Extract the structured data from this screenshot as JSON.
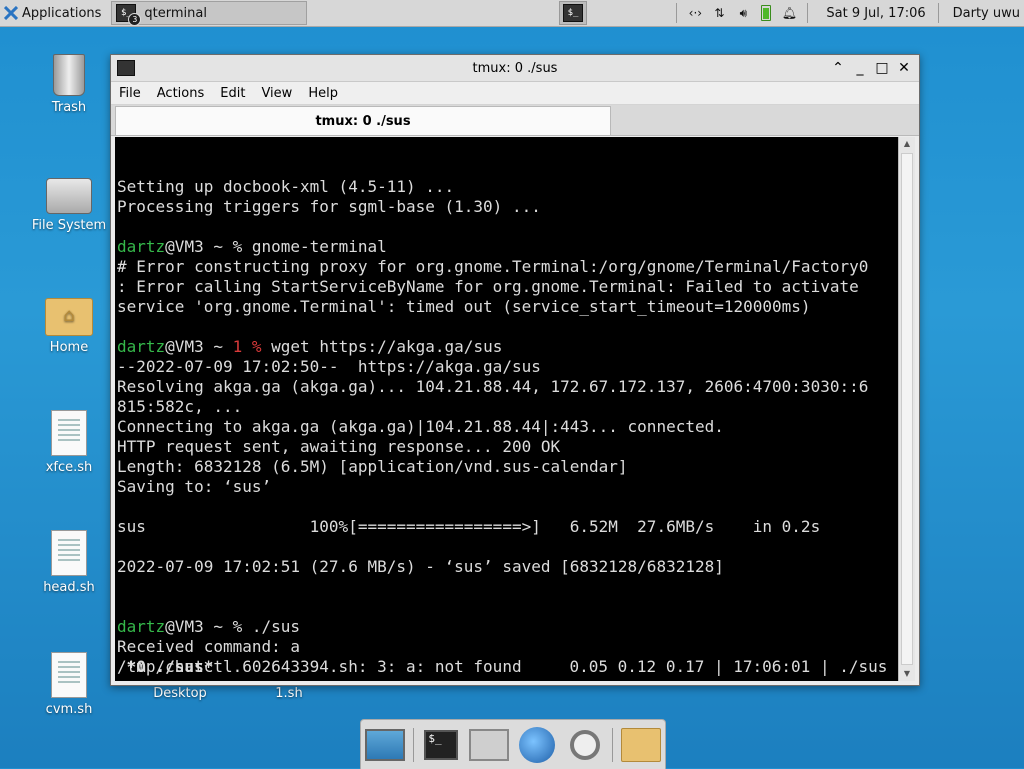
{
  "top_panel": {
    "applications_label": "Applications",
    "task_label": "qterminal",
    "task_badge": "3",
    "clock": "Sat  9 Jul, 17:06",
    "user": "Darty uwu",
    "tray_icons": [
      "network-icon",
      "transfer-icon",
      "volume-icon",
      "battery-icon",
      "bell-icon"
    ]
  },
  "desktop": {
    "icons": [
      {
        "label": "Trash",
        "icon": "trash-icon"
      },
      {
        "label": "File System",
        "icon": "drive-icon"
      },
      {
        "label": "Home",
        "icon": "home-folder-icon"
      },
      {
        "label": "xfce.sh",
        "icon": "script-file-icon"
      },
      {
        "label": "head.sh",
        "icon": "script-file-icon"
      },
      {
        "label": "cvm.sh",
        "icon": "script-file-icon"
      },
      {
        "label": "Desktop",
        "icon": "folder-icon"
      },
      {
        "label": "1.sh",
        "icon": "script-file-icon"
      }
    ]
  },
  "window": {
    "title": "tmux: 0 ./sus",
    "menu": [
      "File",
      "Actions",
      "Edit",
      "View",
      "Help"
    ],
    "tab_label": "tmux: 0 ./sus"
  },
  "terminal": {
    "lines": [
      [
        {
          "t": "Setting up docbook-xml (4.5-11) ..."
        }
      ],
      [
        {
          "t": "Processing triggers for sgml-base (1.30) ..."
        }
      ],
      [
        {
          "t": ""
        }
      ],
      [
        {
          "t": "dartz",
          "c": "g"
        },
        {
          "t": "@VM3 ~ % gnome-terminal"
        }
      ],
      [
        {
          "t": "# Error constructing proxy for org.gnome.Terminal:/org/gnome/Terminal/Factory0"
        }
      ],
      [
        {
          "t": ": Error calling StartServiceByName for org.gnome.Terminal: Failed to activate"
        }
      ],
      [
        {
          "t": "service 'org.gnome.Terminal': timed out (service_start_timeout=120000ms)"
        }
      ],
      [
        {
          "t": ""
        }
      ],
      [
        {
          "t": "dartz",
          "c": "g"
        },
        {
          "t": "@VM3 ~ "
        },
        {
          "t": "1 %",
          "c": "r"
        },
        {
          "t": " wget https://akga.ga/sus"
        }
      ],
      [
        {
          "t": "--2022-07-09 17:02:50--  https://akga.ga/sus"
        }
      ],
      [
        {
          "t": "Resolving akga.ga (akga.ga)... 104.21.88.44, 172.67.172.137, 2606:4700:3030::6"
        }
      ],
      [
        {
          "t": "815:582c, ..."
        }
      ],
      [
        {
          "t": "Connecting to akga.ga (akga.ga)|104.21.88.44|:443... connected."
        }
      ],
      [
        {
          "t": "HTTP request sent, awaiting response... 200 OK"
        }
      ],
      [
        {
          "t": "Length: 6832128 (6.5M) [application/vnd.sus-calendar]"
        }
      ],
      [
        {
          "t": "Saving to: ‘sus’"
        }
      ],
      [
        {
          "t": ""
        }
      ],
      [
        {
          "t": "sus                 100%[=================>]   6.52M  27.6MB/s    in 0.2s"
        }
      ],
      [
        {
          "t": ""
        }
      ],
      [
        {
          "t": "2022-07-09 17:02:51 (27.6 MB/s) - ‘sus’ saved [6832128/6832128]"
        }
      ],
      [
        {
          "t": ""
        }
      ],
      [
        {
          "t": ""
        }
      ],
      [
        {
          "t": "dartz",
          "c": "g"
        },
        {
          "t": "@VM3 ~ % ./sus"
        }
      ],
      [
        {
          "t": "Received command: a"
        }
      ],
      [
        {
          "t": "/tmp/chatctl.602643394.sh: 3: a: not found"
        }
      ]
    ],
    "status_left": " *0 ./sus*",
    "status_right": "0.05 0.12 0.17 | 17:06:01 | ./sus "
  },
  "dock": {
    "items": [
      "show-desktop-icon",
      "terminal-icon",
      "home-folder-icon",
      "web-browser-icon",
      "search-icon",
      "folder-icon"
    ]
  }
}
